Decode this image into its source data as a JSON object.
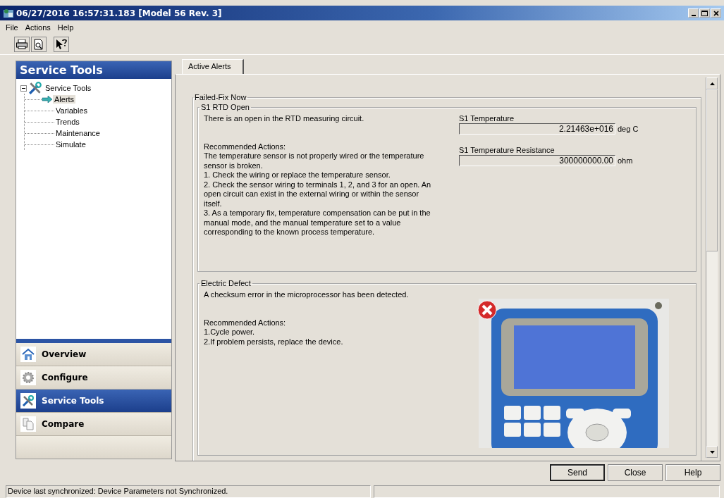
{
  "window": {
    "title": "06/27/2016 16:57:31.183 [Model 56 Rev. 3]"
  },
  "menu": [
    {
      "label": "File"
    },
    {
      "label": "Actions"
    },
    {
      "label": "Help"
    }
  ],
  "toolbar": [
    {
      "kind": "print"
    },
    {
      "kind": "preview"
    },
    {
      "kind": "whats-this"
    }
  ],
  "sidebar": {
    "title": "Service Tools",
    "tree": {
      "label": "Service Tools",
      "expanded": true,
      "children": [
        {
          "label": "Alerts",
          "selected": true
        },
        {
          "label": "Variables",
          "selected": false
        },
        {
          "label": "Trends",
          "selected": false
        },
        {
          "label": "Maintenance",
          "selected": false
        },
        {
          "label": "Simulate",
          "selected": false
        }
      ]
    },
    "nav": [
      {
        "label": "Overview",
        "kind": "home",
        "selected": false
      },
      {
        "label": "Configure",
        "kind": "gear",
        "selected": false
      },
      {
        "label": "Service Tools",
        "kind": "tools",
        "selected": true
      },
      {
        "label": "Compare",
        "kind": "pages",
        "selected": false
      }
    ]
  },
  "tabs": [
    {
      "label": "Active Alerts",
      "selected": true
    }
  ],
  "alert_group": {
    "title": "Failed-Fix Now",
    "alerts": [
      {
        "title": "S1 RTD Open",
        "description": "There is an open in the RTD measuring circuit.",
        "actions_heading": "Recommended Actions:",
        "actions": [
          "The temperature sensor is not properly wired or the temperature sensor is broken.",
          "1. Check the wiring or replace the temperature sensor.",
          "2. Check the sensor wiring to terminals 1, 2, and 3 for an open. An open circuit can exist in the external wiring or within the sensor itself.",
          "3. As a temporary fix, temperature compensation can be put in the manual mode, and the manual temperature set to a value corresponding to the known process temperature."
        ],
        "readings": [
          {
            "label": "S1 Temperature",
            "value": "2.21463e+016",
            "unit": "deg C"
          },
          {
            "label": "S1 Temperature Resistance",
            "value": "300000000.00",
            "unit": "ohm"
          }
        ]
      },
      {
        "title": "Electric Defect",
        "description": "A checksum error in the microprocessor has been detected.",
        "actions_heading": "Recommended Actions:",
        "actions": [
          "1.Cycle power.",
          "2.If problem persists, replace the device."
        ],
        "image": {
          "kind": "picture",
          "error": true
        }
      }
    ]
  },
  "buttons": [
    {
      "label": "Send",
      "default": true
    },
    {
      "label": "Close",
      "default": false
    },
    {
      "label": "Help",
      "default": false
    }
  ],
  "status_bar": {
    "text": "Device last synchronized: Device Parameters not Synchronized."
  }
}
